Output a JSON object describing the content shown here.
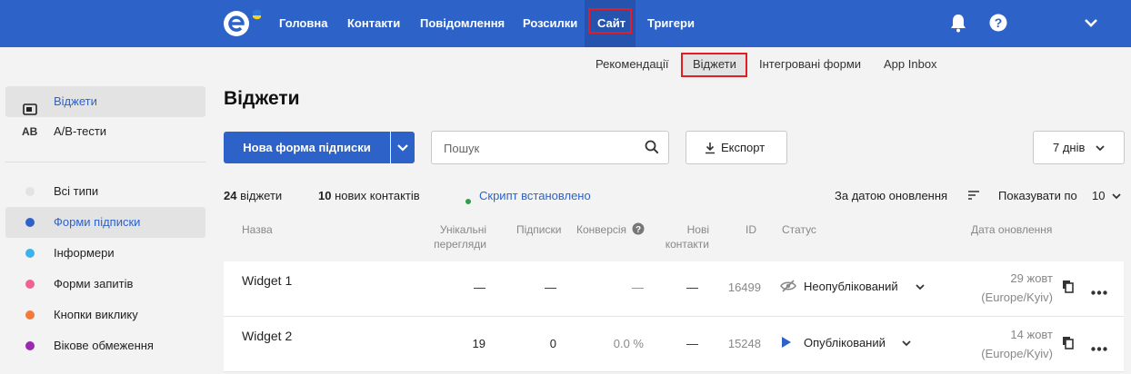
{
  "topnav": {
    "items": [
      "Головна",
      "Контакти",
      "Повідомлення",
      "Розсилки",
      "Сайт",
      "Тригери"
    ],
    "active": "Сайт"
  },
  "subnav": {
    "items": [
      "Рекомендації",
      "Віджети",
      "Інтегровані форми",
      "App Inbox"
    ],
    "active": "Віджети"
  },
  "sidebar": {
    "top_items": [
      {
        "label": "Віджети",
        "icon": "widget-icon",
        "active": true
      },
      {
        "label": "A/B-тести",
        "icon_text": "AB",
        "active": false
      }
    ],
    "type_items": [
      {
        "label": "Всі типи",
        "color": "#e3e3e3"
      },
      {
        "label": "Форми підписки",
        "color": "#2d63c8"
      },
      {
        "label": "Інформери",
        "color": "#3bb3ea"
      },
      {
        "label": "Форми запитів",
        "color": "#f06292"
      },
      {
        "label": "Кнопки виклику",
        "color": "#f47a3c"
      },
      {
        "label": "Вікове обмеження",
        "color": "#9c27b0"
      }
    ]
  },
  "main": {
    "title": "Віджети",
    "new_form_label": "Нова форма підписки",
    "search_placeholder": "Пошук",
    "export_label": "Експорт",
    "period_label": "7 днів",
    "stats": {
      "widgets_count": "24",
      "widgets_label": "віджети",
      "contacts_count": "10",
      "contacts_label": "нових контактів",
      "script_status": "Скрипт встановлено"
    },
    "sort_label": "За датою оновлення",
    "show_per_page_label": "Показувати по",
    "show_per_page_value": "10"
  },
  "table": {
    "headers": {
      "name": "Назва",
      "unique_views_1": "Унікальні",
      "unique_views_2": "перегляди",
      "subscriptions": "Підписки",
      "conversion": "Конверсія",
      "new_contacts_1": "Нові",
      "new_contacts_2": "контакти",
      "id": "ID",
      "status": "Статус",
      "updated": "Дата оновлення"
    },
    "rows": [
      {
        "name": "Widget 1",
        "unique_views": "—",
        "subscriptions": "—",
        "conversion": "—",
        "new_contacts": "—",
        "id": "16499",
        "status": "Неопублікований",
        "date": "29 жовт",
        "tz": "(Europe/Kyiv)"
      },
      {
        "name": "Widget 2",
        "unique_views": "19",
        "subscriptions": "0",
        "conversion": "0.0 %",
        "new_contacts": "—",
        "id": "15248",
        "status": "Опублікований",
        "date": "14 жовт",
        "tz": "(Europe/Kyiv)"
      }
    ]
  },
  "colors": {
    "brand": "#2d63c8",
    "highlight": "#e21d24",
    "published": "#2d63c8",
    "script_ok": "#2e9e4e"
  }
}
